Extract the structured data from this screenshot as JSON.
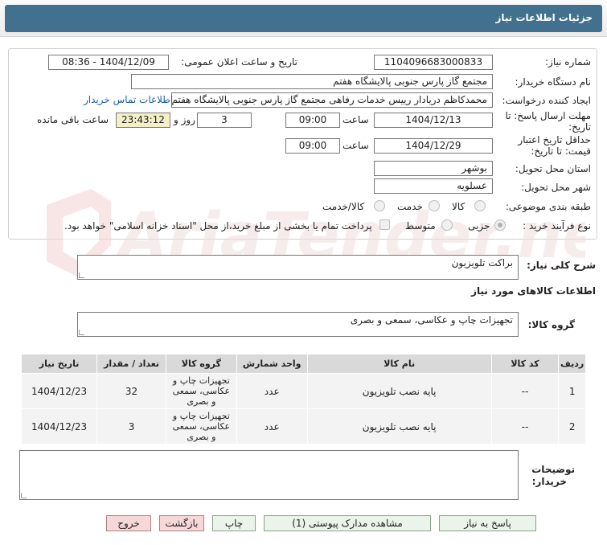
{
  "header": {
    "title": "جزئیات اطلاعات نیاز"
  },
  "form": {
    "need_number": {
      "label": "شماره نیاز:",
      "value": "1104096683000833"
    },
    "announce_datetime": {
      "label": "تاریخ و ساعت اعلان عمومی:",
      "value": "1404/12/09 - 08:36"
    },
    "buyer_org": {
      "label": "نام دستگاه خریدار:",
      "value": "مجتمع گاز پارس جنوبی  پالایشگاه هفتم"
    },
    "request_creator": {
      "label": "ایجاد کننده درخواست:",
      "value": "محمدکاظم دریادار رییس خدمات رفاهی مجتمع گاز پارس جنوبی  پالایشگاه هفتم",
      "contact_link": "اطلاعات تماس خریدار"
    },
    "reply_deadline": {
      "label_line1": "مهلت ارسال پاسخ: تا",
      "label_line2": "تاریخ:",
      "date": "1404/12/13",
      "time_label": "ساعت",
      "time": "09:00",
      "days": "3",
      "days_label": "روز و",
      "remaining": "23:43:12",
      "remaining_label": "ساعت باقی مانده"
    },
    "price_validity": {
      "label_line1": "حداقل تاریخ اعتبار",
      "label_line2": "قیمت: تا تاریخ:",
      "date": "1404/12/29",
      "time_label": "ساعت",
      "time": "09:00"
    },
    "province": {
      "label": "استان محل تحویل:",
      "value": "بوشهر"
    },
    "city": {
      "label": "شهر محل تحویل:",
      "value": "عسلویه"
    },
    "category": {
      "label": "طبقه بندی موضوعی:",
      "options": [
        "کالا",
        "خدمت",
        "کالا/خدمت"
      ]
    },
    "process_type": {
      "label": "نوع فرآیند خرید :",
      "options": [
        "جزیی",
        "متوسط"
      ],
      "note": "پرداخت تمام یا بخشی از مبلغ خرید،از محل \"اسناد خزانه اسلامی\" خواهد بود."
    }
  },
  "summary": {
    "label": "شرح کلی نیاز:",
    "value": "براکت تلویزیون"
  },
  "goods_info": {
    "title": "اطلاعات کالاهای مورد نیاز",
    "group_label": "گروه کالا:",
    "group_value": "تجهیزات چاپ و عکاسی، سمعی و بصری"
  },
  "table": {
    "headers": [
      "ردیف",
      "کد کالا",
      "نام کالا",
      "واحد شمارش",
      "گروه کالا",
      "تعداد / مقدار",
      "تاریخ نیاز"
    ],
    "rows": [
      {
        "row": "1",
        "code": "--",
        "name": "پایه نصب تلویزیون",
        "unit": "عدد",
        "group": "تجهیزات چاپ و عکاسی، سمعی و بصری",
        "qty": "32",
        "date": "1404/12/23"
      },
      {
        "row": "2",
        "code": "--",
        "name": "پایه نصب تلویزیون",
        "unit": "عدد",
        "group": "تجهیزات چاپ و عکاسی، سمعی و بصری",
        "qty": "3",
        "date": "1404/12/23"
      }
    ]
  },
  "buyer_notes": {
    "label_line1": "توضیحات",
    "label_line2": "خریدار:",
    "value": ""
  },
  "buttons": {
    "reply": "پاسخ به نیاز",
    "attachments": "مشاهده مدارک پیوستی (1)",
    "print": "چاپ",
    "back": "بازگشت",
    "exit": "خروج"
  },
  "watermark": {
    "text": "AriaTender.neT"
  },
  "colors": {
    "header": "#41718e",
    "link": "#1a5ea8",
    "highlight": "#f4efc7",
    "watermark": "#f2dede"
  }
}
